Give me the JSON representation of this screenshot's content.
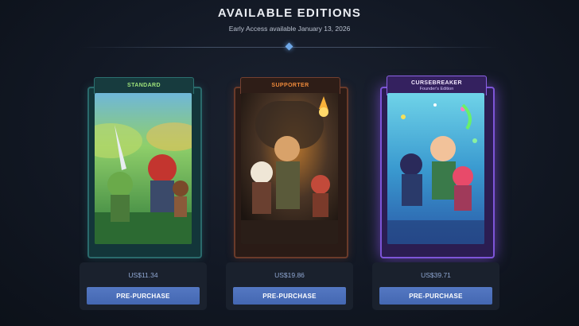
{
  "header": {
    "title": "AVAILABLE EDITIONS",
    "subtitle": "Early Access available January 13, 2026"
  },
  "editions": [
    {
      "name": "STANDARD",
      "subtitle": "",
      "price": "US$11.34",
      "button_label": "PRE-PURCHASE",
      "accent_color": "#9ee37a",
      "frame_color": "#2a6a6c"
    },
    {
      "name": "SUPPORTER",
      "subtitle": "",
      "price": "US$19.86",
      "button_label": "PRE-PURCHASE",
      "accent_color": "#f08a3a",
      "frame_color": "#6a3a2a"
    },
    {
      "name": "CURSEBREAKER",
      "subtitle": "Founder's Edition",
      "price": "US$39.71",
      "button_label": "PRE-PURCHASE",
      "accent_color": "#f3e8ff",
      "frame_color": "#7d55d8"
    }
  ],
  "colors": {
    "background": "#121824",
    "button": "#4a6cb8",
    "price_text": "#8fa7d2"
  }
}
